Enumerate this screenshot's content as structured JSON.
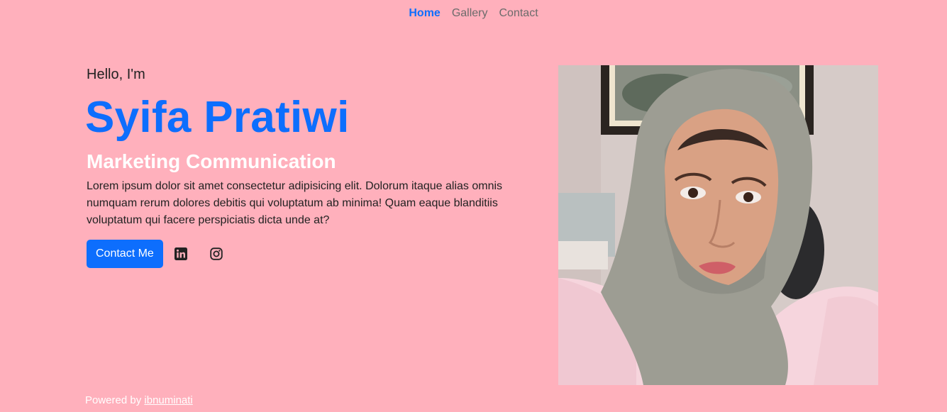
{
  "nav": {
    "items": [
      {
        "label": "Home",
        "active": true
      },
      {
        "label": "Gallery",
        "active": false
      },
      {
        "label": "Contact",
        "active": false
      }
    ]
  },
  "hero": {
    "intro": "Hello, I'm",
    "name": "Syifa Pratiwi",
    "role": "Marketing Communication",
    "description": "Lorem ipsum dolor sit amet consectetur adipisicing elit. Dolorum itaque alias omnis numquam rerum dolores debitis qui voluptatum ab minima! Quam eaque blanditiis voluptatum qui facere perspiciatis dicta unde at?",
    "cta_label": "Contact Me",
    "social_icons": [
      "linkedin-icon",
      "instagram-icon"
    ]
  },
  "footer": {
    "prefix": "Powered by ",
    "link_text": "ibnuminati"
  },
  "colors": {
    "background": "#ffb0bc",
    "accent": "#0d6efd",
    "nav_inactive": "#6b6b6b",
    "role_text": "#ffffff"
  }
}
